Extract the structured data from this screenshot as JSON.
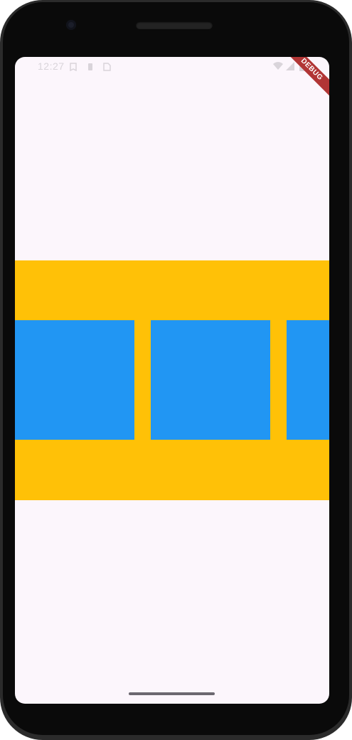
{
  "status_bar": {
    "time": "12:27",
    "left_icons": [
      "notification-icon",
      "battery-saver-icon",
      "sim-icon"
    ],
    "right_icons": [
      "wifi-icon",
      "cell-signal-icon",
      "battery-icon"
    ]
  },
  "debug_banner": {
    "label": "DEBUG"
  },
  "colors": {
    "background": "#fcf6fc",
    "band": "#ffc107",
    "box": "#2196f3",
    "debug_ribbon": "#b13535"
  },
  "scroller": {
    "item_count_visible": 3
  }
}
